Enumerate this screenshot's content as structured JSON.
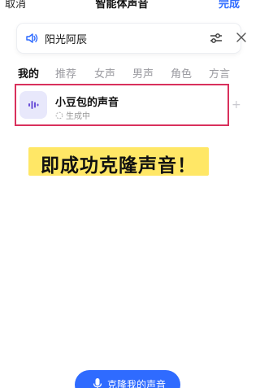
{
  "header": {
    "cancel_label": "取消",
    "title": "智能体声音",
    "done_label": "完成"
  },
  "current_voice": {
    "name": "阳光阿辰",
    "speaker_icon": "speaker-icon",
    "adjust_icon": "sliders-icon",
    "close_icon": "close-icon"
  },
  "tabs": [
    {
      "label": "我的",
      "active": true
    },
    {
      "label": "推荐",
      "active": false
    },
    {
      "label": "女声",
      "active": false
    },
    {
      "label": "男声",
      "active": false
    },
    {
      "label": "角色",
      "active": false
    },
    {
      "label": "方言",
      "active": false
    }
  ],
  "voice_item": {
    "name": "小豆包的声音",
    "status": "生成中",
    "icon": "waveform-icon"
  },
  "edge_glyph": "+",
  "banner": {
    "text": "即成功克隆声音！"
  },
  "clone_button": {
    "label": "克隆我的声音",
    "icon": "microphone-icon"
  },
  "colors": {
    "accent": "#2f6bff",
    "highlight_border": "#d9305c",
    "banner_bg": "#ffe766",
    "thumb_bg": "#e8e8fb",
    "waveform": "#6a4fd8"
  }
}
